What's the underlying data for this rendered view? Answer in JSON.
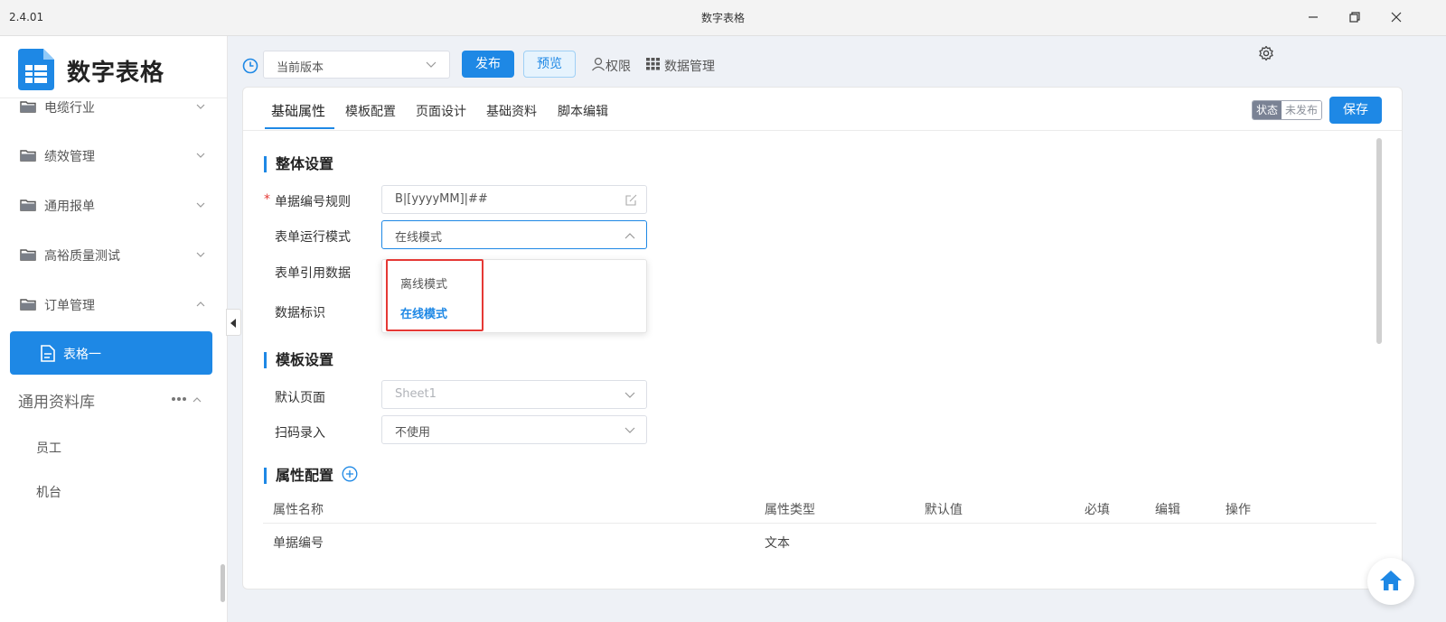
{
  "titlebar": {
    "version": "2.4.01",
    "title": "数字表格"
  },
  "app": {
    "name": "数字表格"
  },
  "sidebar": {
    "items": [
      {
        "label": "电缆行业",
        "expanded": false
      },
      {
        "label": "绩效管理",
        "expanded": false
      },
      {
        "label": "通用报单",
        "expanded": false
      },
      {
        "label": "高裕质量测试",
        "expanded": false
      },
      {
        "label": "订单管理",
        "expanded": true
      }
    ],
    "active_item": "表格一",
    "group": {
      "title": "通用资料库",
      "items": [
        "员工",
        "机台"
      ]
    }
  },
  "toolbar": {
    "version_select": "当前版本",
    "publish_label": "发布",
    "preview_label": "预览",
    "permission_label": "权限",
    "data_manage_label": "数据管理"
  },
  "tabs": [
    "基础属性",
    "模板配置",
    "页面设计",
    "基础资料",
    "脚本编辑"
  ],
  "status": {
    "key": "状态",
    "value": "未发布"
  },
  "save_label": "保存",
  "overall": {
    "title": "整体设置",
    "doc_rule_label": "单据编号规则",
    "doc_rule_value": "B|[yyyyMM]|##",
    "run_mode_label": "表单运行模式",
    "run_mode_value": "在线模式",
    "ref_data_label": "表单引用数据",
    "data_flag_label": "数据标识",
    "dropdown_options": [
      "离线模式",
      "在线模式"
    ]
  },
  "template": {
    "title": "模板设置",
    "default_page_label": "默认页面",
    "default_page_value": "Sheet1",
    "scan_label": "扫码录入",
    "scan_value": "不使用"
  },
  "props": {
    "title": "属性配置",
    "columns": [
      "属性名称",
      "属性类型",
      "默认值",
      "必填",
      "编辑",
      "操作"
    ],
    "rows": [
      {
        "name": "单据编号",
        "type": "文本"
      }
    ]
  },
  "colors": {
    "accent": "#1e88e5",
    "highlight": "#e53935"
  }
}
